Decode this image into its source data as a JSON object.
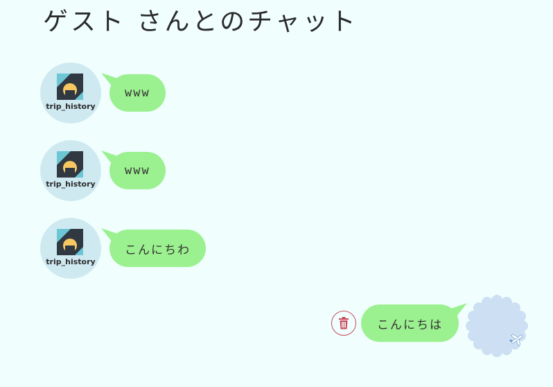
{
  "page": {
    "title": "ゲスト さんとのチャット"
  },
  "partner": {
    "avatar_label": "trip_history",
    "avatar_icon": "trip-history-logo-icon"
  },
  "messages": [
    {
      "side": "left",
      "text": "www"
    },
    {
      "side": "left",
      "text": "www"
    },
    {
      "side": "left",
      "text": "こんにちわ"
    },
    {
      "side": "right",
      "text": "こんにちは"
    }
  ],
  "actions": {
    "delete_icon": "trash-icon"
  },
  "colors": {
    "background": "#f0fffe",
    "bubble": "#9bf08f",
    "avatar_bg": "#cfe9f1",
    "guest_avatar_bg": "#cddff3",
    "delete_accent": "#c8485a"
  }
}
